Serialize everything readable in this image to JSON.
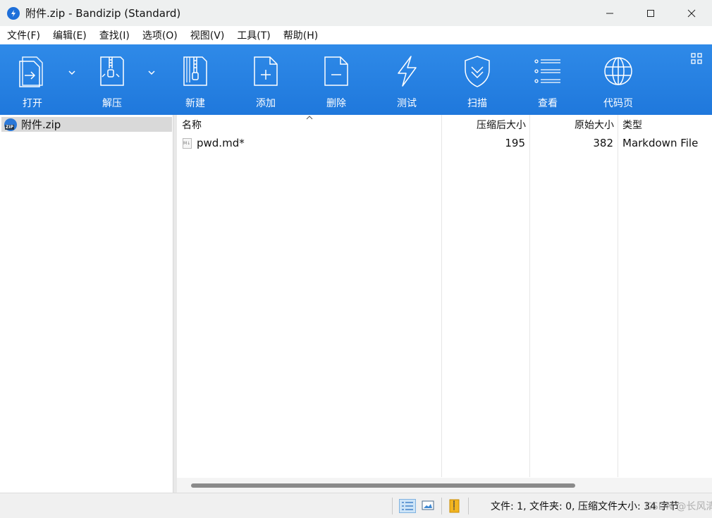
{
  "window": {
    "title": "附件.zip - Bandizip (Standard)"
  },
  "menu": [
    "文件(F)",
    "编辑(E)",
    "查找(I)",
    "选项(O)",
    "视图(V)",
    "工具(T)",
    "帮助(H)"
  ],
  "toolbar": {
    "open": "打开",
    "extract": "解压",
    "new": "新建",
    "add": "添加",
    "delete": "删除",
    "test": "测试",
    "scan": "扫描",
    "view": "查看",
    "codepage": "代码页"
  },
  "tree": {
    "root": "附件.zip",
    "badge": "ZIP"
  },
  "columns": {
    "name": "名称",
    "compressed": "压缩后大小",
    "original": "原始大小",
    "type": "类型"
  },
  "files": [
    {
      "name": "pwd.md*",
      "compressed": "195",
      "original": "382",
      "type": "Markdown File"
    }
  ],
  "status": {
    "text": "文件: 1, 文件夹: 0, 压缩文件大小: 34 字节",
    "watermark": "CSDN @长风清君"
  },
  "colors": {
    "accent": "#1f78dc",
    "selection": "#d9d9d9"
  }
}
